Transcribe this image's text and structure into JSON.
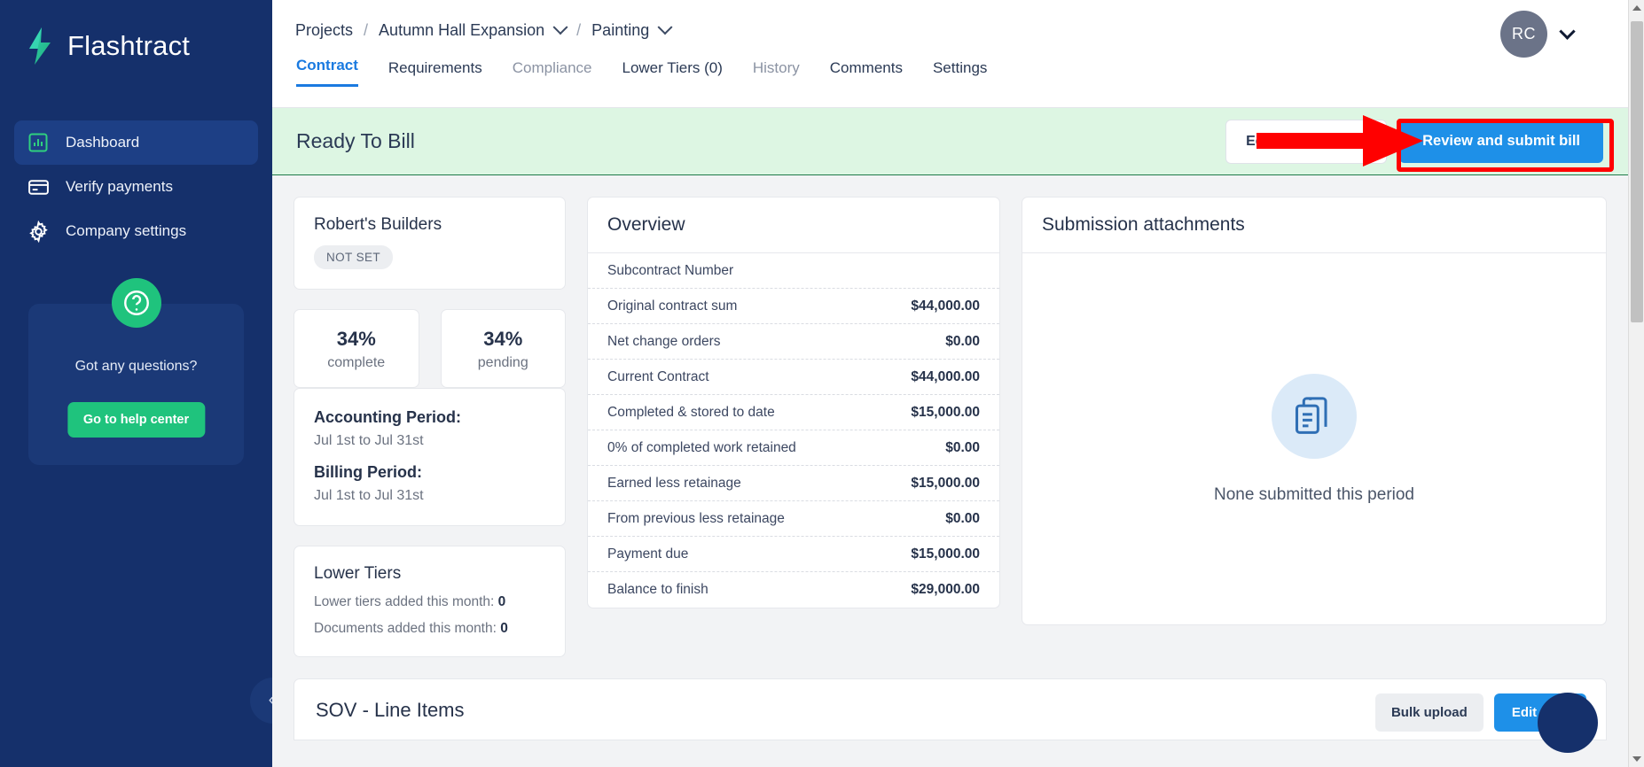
{
  "sidebar": {
    "brand": "Flashtract",
    "logo_icon": "lightning-bolt-icon",
    "items": [
      {
        "label": "Dashboard",
        "icon": "bar-chart-icon",
        "active": true
      },
      {
        "label": "Verify payments",
        "icon": "credit-card-icon",
        "active": false
      },
      {
        "label": "Company settings",
        "icon": "gear-icon",
        "active": false
      }
    ],
    "help": {
      "icon": "question-mark-circle-icon",
      "text": "Got any questions?",
      "button": "Go to help center"
    },
    "collapse_icon": "double-chevron-left-icon"
  },
  "breadcrumb": {
    "items": [
      {
        "label": "Projects",
        "has_caret": false
      },
      {
        "label": "Autumn Hall Expansion",
        "has_caret": true
      },
      {
        "label": "Painting",
        "has_caret": true
      }
    ],
    "separator": "/"
  },
  "tabs": [
    {
      "label": "Contract",
      "state": "active"
    },
    {
      "label": "Requirements",
      "state": "dark"
    },
    {
      "label": "Compliance",
      "state": "muted"
    },
    {
      "label": "Lower Tiers (0)",
      "state": "dark"
    },
    {
      "label": "History",
      "state": "muted"
    },
    {
      "label": "Comments",
      "state": "dark"
    },
    {
      "label": "Settings",
      "state": "dark"
    }
  ],
  "account": {
    "initials": "RC",
    "chevron_icon": "chevron-down-icon"
  },
  "banner": {
    "status": "Ready To Bill",
    "edit_label": "Edit invoice items",
    "submit_label": "Review and submit bill",
    "highlight_color": "#ff0000",
    "background": "#ddf6e3",
    "primary_color": "#1e90e8"
  },
  "annotation": {
    "arrow_icon": "red-right-arrow-icon",
    "color": "#ff0000"
  },
  "vendor": {
    "name": "Robert's Builders",
    "badge": "NOT SET"
  },
  "stats": [
    {
      "value": "34%",
      "label": "complete"
    },
    {
      "value": "34%",
      "label": "pending"
    }
  ],
  "periods": {
    "accounting_label": "Accounting Period:",
    "accounting_value": "Jul 1st to Jul 31st",
    "billing_label": "Billing Period:",
    "billing_value": "Jul 1st to Jul 31st"
  },
  "lower_tiers": {
    "title": "Lower Tiers",
    "added_label": "Lower tiers added this month:",
    "added_value": "0",
    "docs_label": "Documents added this month:",
    "docs_value": "0"
  },
  "overview": {
    "title": "Overview",
    "rows": [
      {
        "label": "Subcontract Number",
        "value": ""
      },
      {
        "label": "Original contract sum",
        "value": "$44,000.00"
      },
      {
        "label": "Net change orders",
        "value": "$0.00"
      },
      {
        "label": "Current Contract",
        "value": "$44,000.00"
      },
      {
        "label": "Completed & stored to date",
        "value": "$15,000.00"
      },
      {
        "label": "0% of completed work retained",
        "value": "$0.00"
      },
      {
        "label": "Earned less retainage",
        "value": "$15,000.00"
      },
      {
        "label": "From previous less retainage",
        "value": "$0.00"
      },
      {
        "label": "Payment due",
        "value": "$15,000.00"
      },
      {
        "label": "Balance to finish",
        "value": "$29,000.00"
      }
    ]
  },
  "attachments": {
    "title": "Submission attachments",
    "empty_icon": "documents-stack-icon",
    "empty_text": "None submitted this period"
  },
  "sov": {
    "title": "SOV - Line Items",
    "bulk_upload_label": "Bulk upload",
    "edit_label": "Edit SOV"
  },
  "chat": {
    "icon": "chat-bubble-icon"
  },
  "scrollbar": {
    "up_icon": "scroll-up-arrow-icon",
    "down_icon": "scroll-down-arrow-icon"
  }
}
